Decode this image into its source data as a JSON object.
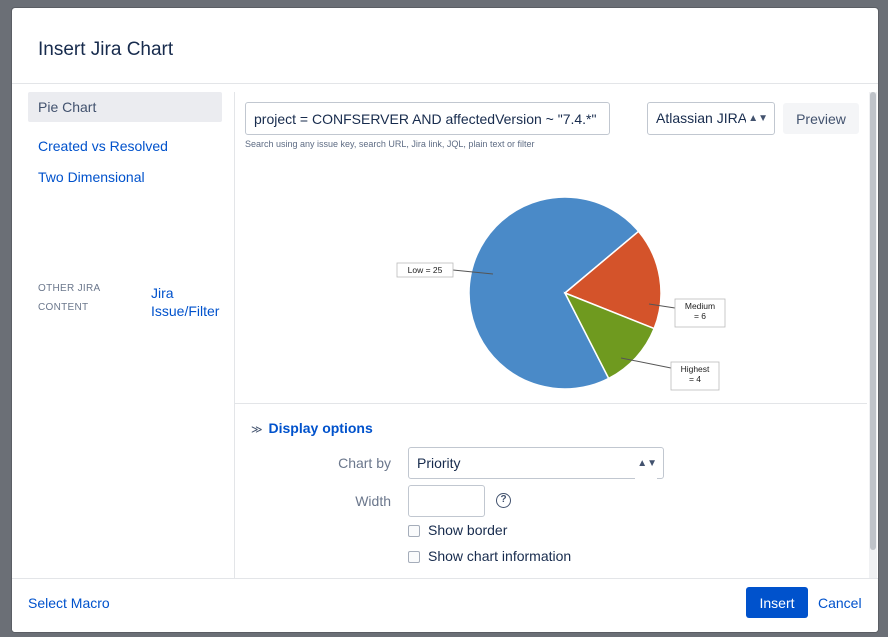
{
  "dialog": {
    "title": "Insert Jira Chart"
  },
  "sidebar": {
    "items": [
      {
        "label": "Pie Chart",
        "active": true
      },
      {
        "label": "Created vs Resolved",
        "active": false
      },
      {
        "label": "Two Dimensional",
        "active": false
      }
    ],
    "other_label": "OTHER JIRA CONTENT",
    "other_link": "Jira Issue/Filter"
  },
  "search": {
    "value": "project = CONFSERVER AND affectedVersion ~ \"7.4.*\"",
    "helper": "Search using any issue key, search URL, Jira link, JQL, plain text or filter"
  },
  "server": {
    "selected": "Atlassian JIRA ("
  },
  "toolbar": {
    "preview_label": "Preview"
  },
  "chart_data": {
    "type": "pie",
    "title": "",
    "slices": [
      {
        "label": "Low",
        "value": 25,
        "display": "Low = 25",
        "color": "#4a8ac8"
      },
      {
        "label": "Medium",
        "value": 6,
        "display_lines": [
          "Medium",
          "= 6"
        ],
        "color": "#d4532a"
      },
      {
        "label": "Highest",
        "value": 4,
        "display_lines": [
          "Highest",
          "= 4"
        ],
        "color": "#6f9a1f"
      }
    ]
  },
  "options": {
    "toggle_label": "Display options",
    "chart_by_label": "Chart by",
    "chart_by_value": "Priority",
    "width_label": "Width",
    "width_value": "",
    "show_border_label": "Show border",
    "show_info_label": "Show chart information"
  },
  "footer": {
    "select_macro": "Select Macro",
    "insert_label": "Insert",
    "cancel_label": "Cancel"
  },
  "colors": {
    "accent": "#0052cc",
    "text": "#172b4d"
  }
}
